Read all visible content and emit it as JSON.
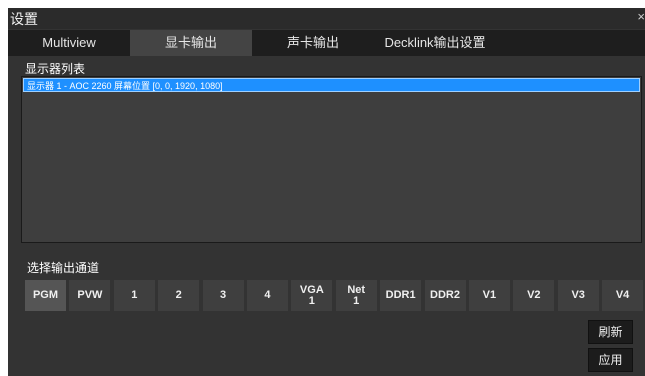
{
  "window": {
    "title": "设置",
    "close_label": "×"
  },
  "tabs": [
    {
      "label": "Multiview"
    },
    {
      "label": "显卡输出"
    },
    {
      "label": "声卡输出"
    },
    {
      "label": "Decklink输出设置"
    }
  ],
  "display_list": {
    "label": "显示器列表",
    "items": [
      {
        "text": "显示器 1 - AOC 2260 屏幕位置 [0, 0, 1920, 1080]"
      }
    ]
  },
  "channel_select": {
    "label": "选择输出通道",
    "channels": [
      {
        "label": "PGM"
      },
      {
        "label": "PVW"
      },
      {
        "label": "1"
      },
      {
        "label": "2"
      },
      {
        "label": "3"
      },
      {
        "label": "4"
      },
      {
        "label": "VGA\n1"
      },
      {
        "label": "Net\n1"
      },
      {
        "label": "DDR1"
      },
      {
        "label": "DDR2"
      },
      {
        "label": "V1"
      },
      {
        "label": "V2"
      },
      {
        "label": "V3"
      },
      {
        "label": "V4"
      }
    ]
  },
  "actions": {
    "refresh_label": "刷新",
    "apply_label": "应用"
  },
  "colors": {
    "background": "#333333",
    "tab_bar": "#1e1e1e",
    "active_tab": "#444444",
    "selection": "#1e90ff"
  }
}
